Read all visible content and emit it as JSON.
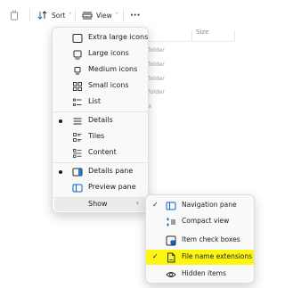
{
  "toolbar": {
    "sort_label": "Sort",
    "view_label": "View",
    "more_label": "···"
  },
  "file_list": {
    "columns": [
      "Size"
    ],
    "rows": [
      "folder",
      "folder",
      "folder",
      "folder"
    ]
  },
  "view_menu": {
    "items": [
      {
        "label": "Extra large icons",
        "icon": "extra-large-icons-icon",
        "selected": false
      },
      {
        "label": "Large icons",
        "icon": "large-icons-icon",
        "selected": false
      },
      {
        "label": "Medium icons",
        "icon": "medium-icons-icon",
        "selected": false
      },
      {
        "label": "Small icons",
        "icon": "small-icons-icon",
        "selected": false
      },
      {
        "label": "List",
        "icon": "list-icon",
        "selected": false
      },
      {
        "label": "Details",
        "icon": "details-icon",
        "selected": true
      },
      {
        "label": "Tiles",
        "icon": "tiles-icon",
        "selected": false
      },
      {
        "label": "Content",
        "icon": "content-icon",
        "selected": false
      },
      {
        "label": "Details pane",
        "icon": "details-pane-icon",
        "selected": true
      },
      {
        "label": "Preview pane",
        "icon": "preview-pane-icon",
        "selected": false
      },
      {
        "label": "Show",
        "icon": "",
        "selected": false
      }
    ]
  },
  "show_submenu": {
    "items": [
      {
        "label": "Navigation pane",
        "icon": "navigation-pane-icon",
        "checked": true,
        "highlighted": false
      },
      {
        "label": "Compact view",
        "icon": "compact-view-icon",
        "checked": false,
        "highlighted": false
      },
      {
        "label": "Item check boxes",
        "icon": "item-check-boxes-icon",
        "checked": false,
        "highlighted": false
      },
      {
        "label": "File name extensions",
        "icon": "file-name-extensions-icon",
        "checked": true,
        "highlighted": true
      },
      {
        "label": "Hidden items",
        "icon": "hidden-items-icon",
        "checked": false,
        "highlighted": false
      }
    ],
    "highlight_color": "#fdf614"
  },
  "checkmark": "✓",
  "chevron": "›"
}
